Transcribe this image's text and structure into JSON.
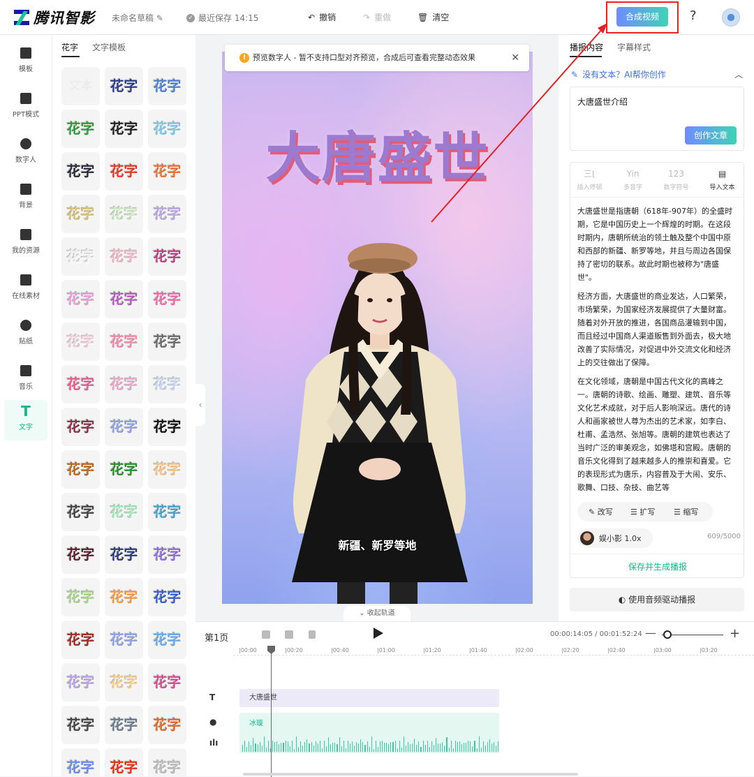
{
  "header": {
    "app_name": "腾讯智影",
    "draft_name": "未命名草稿",
    "saved_text": "最近保存 14:15",
    "undo_label": "撤销",
    "redo_label": "重做",
    "clear_label": "清空",
    "compose_label": "合成视频",
    "help_label": "?"
  },
  "rail": {
    "items": [
      {
        "label": "模板"
      },
      {
        "label": "PPT模式"
      },
      {
        "label": "数字人"
      },
      {
        "label": "背景"
      },
      {
        "label": "我的资源"
      },
      {
        "label": "在线素材"
      },
      {
        "label": "贴纸"
      },
      {
        "label": "音乐"
      },
      {
        "label": "文字"
      }
    ],
    "active_icon": "T"
  },
  "style_panel": {
    "tabs": [
      "花字",
      "文字模板"
    ],
    "first_tile": "文本",
    "tile_text": "花字",
    "tiles": [
      {
        "text": "文本",
        "color": "#e9e9ea"
      },
      {
        "text": "花字",
        "color": "#2b3d86"
      },
      {
        "text": "花字",
        "color": "#4f7fd0"
      },
      {
        "text": "花字",
        "color": "#2f9a3a"
      },
      {
        "text": "花字",
        "color": "#222222"
      },
      {
        "text": "花字",
        "color": "#7ec8e6"
      },
      {
        "text": "花字",
        "color": "#2a2a3a"
      },
      {
        "text": "花字",
        "color": "#e23b2a"
      },
      {
        "text": "花字",
        "color": "#e8703a"
      },
      {
        "text": "花字",
        "color": "#d6c07a"
      },
      {
        "text": "花字",
        "color": "#cfe6c3"
      },
      {
        "text": "花字",
        "color": "#b9a6e0"
      },
      {
        "text": "花字",
        "color": "#ececec"
      },
      {
        "text": "花字",
        "color": "#f2b6c6"
      },
      {
        "text": "花字",
        "color": "#b8407e"
      },
      {
        "text": "花字",
        "color": "#e3a0d2"
      },
      {
        "text": "花字",
        "color": "#b45bc0"
      },
      {
        "text": "花字",
        "color": "#ee6aa6"
      },
      {
        "text": "花字",
        "color": "#f0d2dc"
      },
      {
        "text": "花字",
        "color": "#f08aa6"
      },
      {
        "text": "花字",
        "color": "#6a6a6a"
      },
      {
        "text": "花字",
        "color": "#f05a8a"
      },
      {
        "text": "花字",
        "color": "#e9a9c6"
      },
      {
        "text": "花字",
        "color": "#c9d6ee"
      },
      {
        "text": "花字",
        "color": "#8a2f4a"
      },
      {
        "text": "花字",
        "color": "#8f9ee6"
      },
      {
        "text": "花字",
        "color": "#111111"
      },
      {
        "text": "花字",
        "color": "#b8661e"
      },
      {
        "text": "花字",
        "color": "#2c8c2c"
      },
      {
        "text": "花字",
        "color": "#f4c38a"
      },
      {
        "text": "花字",
        "color": "#444444"
      },
      {
        "text": "花字",
        "color": "#a6e6bd"
      },
      {
        "text": "花字",
        "color": "#4aa0c6"
      },
      {
        "text": "花字",
        "color": "#5a2030"
      },
      {
        "text": "花字",
        "color": "#2a3a7a"
      },
      {
        "text": "花字",
        "color": "#8a6ed6"
      },
      {
        "text": "花字",
        "color": "#a6d48a"
      },
      {
        "text": "花字",
        "color": "#f39a4a"
      },
      {
        "text": "花字",
        "color": "#3a5ad0"
      },
      {
        "text": "花字",
        "color": "#9a2a20"
      },
      {
        "text": "花字",
        "color": "#8ea0e0"
      },
      {
        "text": "花字",
        "color": "#6aa8e6"
      },
      {
        "text": "花字",
        "color": "#b7a0ea"
      },
      {
        "text": "花字",
        "color": "#f4d08a"
      },
      {
        "text": "花字",
        "color": "#d84a8a"
      },
      {
        "text": "花字",
        "color": "#444444"
      },
      {
        "text": "花字",
        "color": "#6a7a8a"
      },
      {
        "text": "花字",
        "color": "#e2672a"
      },
      {
        "text": "花字",
        "color": "#6a8ae6"
      },
      {
        "text": "花字",
        "color": "#e2321e"
      },
      {
        "text": "花字",
        "color": "#bcbcbc"
      }
    ]
  },
  "stage": {
    "notice": "预览数字人 - 暂不支持口型对齐预览，合成后可查看完整动态效果",
    "video_title": "大唐盛世",
    "subtitle": "新疆、新罗等地",
    "collapse_label": "收起轨道"
  },
  "right_panel": {
    "tabs": [
      "播报内容",
      "字幕样式"
    ],
    "ai_prompt": "没有文本？AI帮你创作",
    "topic": "大唐盛世介绍",
    "create_label": "创作文章",
    "tools": [
      {
        "glyph": "三⌊",
        "label": "插入停顿"
      },
      {
        "glyph": "Yin",
        "label": "多音字"
      },
      {
        "glyph": "123",
        "label": "数字符号"
      },
      {
        "glyph": "▤",
        "label": "导入文本"
      }
    ],
    "paragraphs": [
      "大唐盛世是指唐朝（618年-907年）的全盛时期，它是中国历史上一个辉煌的时期。在这段时期内，唐朝所统治的领土触及整个中国中原和西部的新疆、新罗等地，并且与周边各国保持了密切的联系。故此时期也被称为\"唐盛世\"。",
      "经济方面，大唐盛世的商业发达，人口繁荣，市场繁荣，为国家经济发展提供了大量财富。随着对外开放的推进，各国商品灌输到中国，而且经过中国商人渠道贩售到外面去，极大地改善了实际情况，对促进中外交流文化和经济上的交往做出了保障。",
      "在文化领域，唐朝是中国古代文化的高峰之一。唐朝的诗歌、绘画、雕塑、建筑、音乐等文化艺术成就，对于后人影响深远。唐代的诗人和画家被世人尊为杰出的艺术家，如李白、杜甫、孟浩然、张旭等。唐朝的建筑也表达了当时广泛的审美观念，如佛塔和宫殿。唐朝的音乐文化得到了越来越多人的推崇和喜爱。它的表现形式为唐乐，内容普及于大闹、安乐、歌舞、口技、杂技、曲艺等"
    ],
    "actions": [
      {
        "label": "改写"
      },
      {
        "label": "扩写"
      },
      {
        "label": "缩写"
      }
    ],
    "voice": "娱小影  1.0x",
    "count": "609/5000",
    "save_generate": "保存并生成播报",
    "audio_drive": "使用音频驱动播报"
  },
  "timeline": {
    "page_label": "第1页",
    "time": "00:00:14:05 / 00:01:52:24",
    "ticks": [
      "00:00",
      "00:20",
      "00:40",
      "01:00",
      "01:20",
      "01:40",
      "02:00",
      "02:20",
      "02:40",
      "03:00",
      "03:20"
    ],
    "text_clip": "大唐盛世",
    "voice_clip": "冰璇"
  },
  "colors": {
    "accent": "#12b886",
    "compose_gradient_start": "#6f8cff",
    "compose_gradient_end": "#3fd3b7",
    "annotation": "#e22222"
  }
}
